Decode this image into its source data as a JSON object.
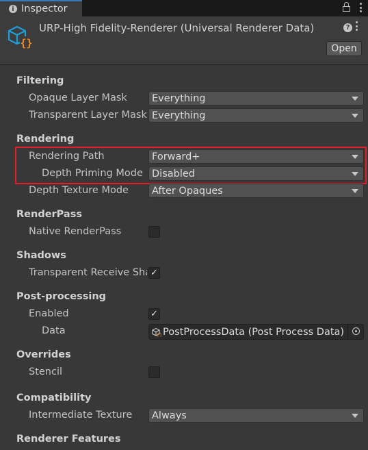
{
  "tab": {
    "label": "Inspector"
  },
  "header": {
    "title": "URP-High Fidelity-Renderer (Universal Renderer Data)",
    "open_label": "Open",
    "accent_color": "#1e9fd8",
    "accent_color_2": "#f08a24"
  },
  "sections": {
    "filtering": "Filtering",
    "rendering": "Rendering",
    "renderpass": "RenderPass",
    "shadows": "Shadows",
    "postprocessing": "Post-processing",
    "overrides": "Overrides",
    "compatibility": "Compatibility",
    "renderer_features": "Renderer Features"
  },
  "fields": {
    "opaque_layer_mask": {
      "label": "Opaque Layer Mask",
      "value": "Everything"
    },
    "transparent_layer_mask": {
      "label": "Transparent Layer Mask",
      "value": "Everything"
    },
    "rendering_path": {
      "label": "Rendering Path",
      "value": "Forward+"
    },
    "depth_priming_mode": {
      "label": "Depth Priming Mode",
      "value": "Disabled"
    },
    "depth_texture_mode": {
      "label": "Depth Texture Mode",
      "value": "After Opaques"
    },
    "native_renderpass": {
      "label": "Native RenderPass",
      "checked": false
    },
    "transparent_receive_shadows": {
      "label": "Transparent Receive Shadows",
      "checked": true
    },
    "pp_enabled": {
      "label": "Enabled",
      "checked": true
    },
    "pp_data": {
      "label": "Data",
      "value": "PostProcessData (Post Process Data)"
    },
    "stencil": {
      "label": "Stencil",
      "checked": false
    },
    "intermediate_texture": {
      "label": "Intermediate Texture",
      "value": "Always"
    }
  },
  "highlight_color": "#e0202a",
  "check_glyph": "✓"
}
